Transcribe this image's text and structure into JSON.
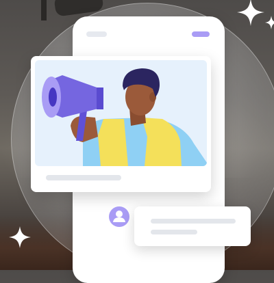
{
  "scene": {
    "background": "dusk-landscape-photo",
    "illustration": "person-with-megaphone",
    "icons": [
      "megaphone-icon",
      "user-icon",
      "sparkle-icon"
    ]
  },
  "colors": {
    "accent": "#a99cf5",
    "megaphone": "#7566e0",
    "vest": "#f4e05a",
    "shirt": "#8fd0f4",
    "skin": "#9b5a3a",
    "hair": "#2b2560",
    "card": "#ffffff",
    "placeholder_line": "#e3e6eb",
    "image_bg": "#e6f1fc"
  }
}
